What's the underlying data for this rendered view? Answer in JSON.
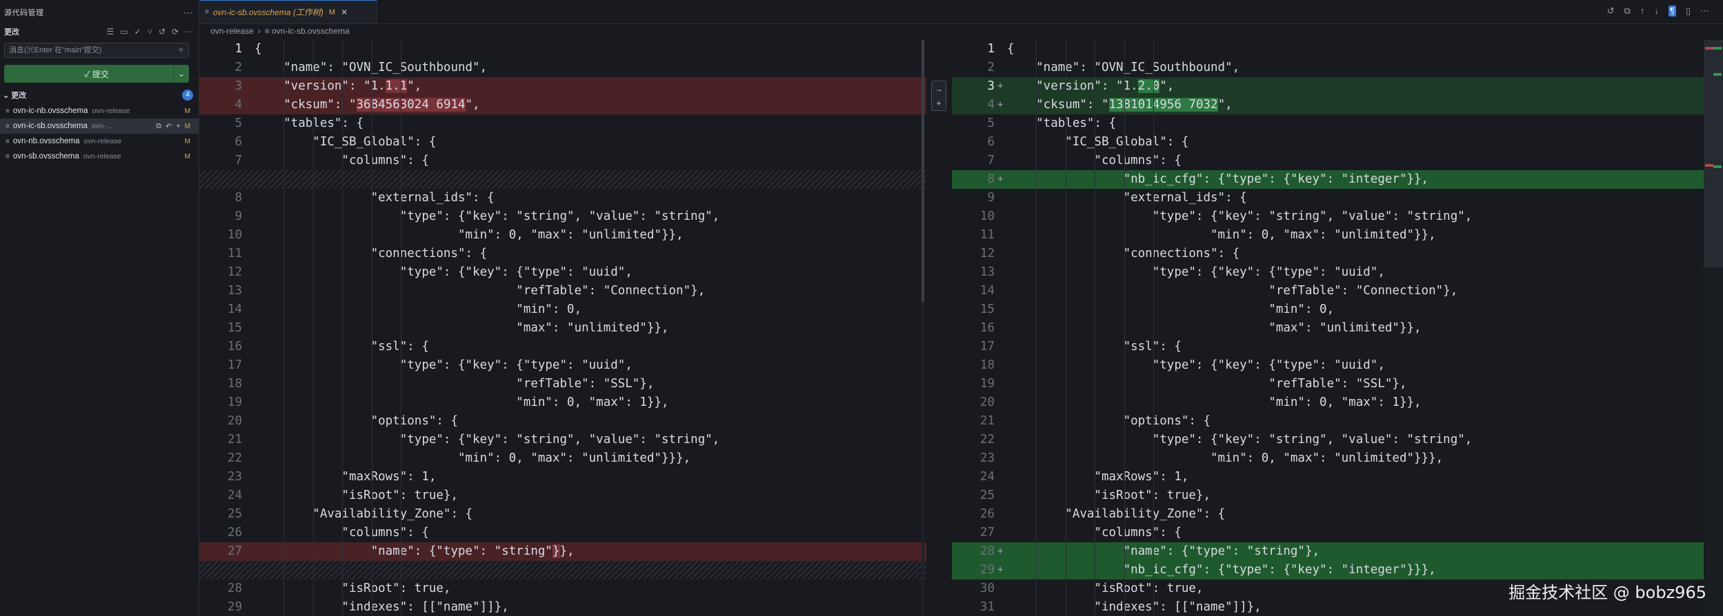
{
  "sidebar": {
    "title": "源代码管理",
    "section_label": "更改",
    "commit_placeholder": "消息(⌘Enter 在\"main\"提交)",
    "commit_button": "✓ 提交",
    "changes_label": "更改",
    "changes_count": "4",
    "files": [
      {
        "name": "ovn-ic-nb.ovsschema",
        "dir": "ovn-release",
        "status": "M"
      },
      {
        "name": "ovn-ic-sb.ovsschema",
        "dir": "ovn-...",
        "status": "M"
      },
      {
        "name": "ovn-nb.ovsschema",
        "dir": "ovn-release",
        "status": "M"
      },
      {
        "name": "ovn-sb.ovsschema",
        "dir": "ovn-release",
        "status": "M"
      }
    ]
  },
  "tab": {
    "title": "ovn-ic-sb.ovsschema (工作树)",
    "status": "M"
  },
  "breadcrumb": [
    "ovn-release",
    "ovn-ic-sb.ovsschema"
  ],
  "left": [
    {
      "n": "1",
      "t": "{"
    },
    {
      "n": "2",
      "t": "    \"name\": \"OVN_IC_Southbound\","
    },
    {
      "n": "3",
      "t": "    \"version\": \"1.1.1\",",
      "k": "del",
      "pre": "    \"version\": \"1.",
      "hl": "1.1",
      "post": "\","
    },
    {
      "n": "4",
      "t": "    \"cksum\": \"3684563024 6914\",",
      "k": "del",
      "pre": "    \"cksum\": \"",
      "hl": "3684563024 6914",
      "post": "\","
    },
    {
      "n": "5",
      "t": "    \"tables\": {"
    },
    {
      "n": "6",
      "t": "        \"IC_SB_Global\": {"
    },
    {
      "n": "7",
      "t": "            \"columns\": {"
    },
    {
      "n": "",
      "t": "",
      "k": "hatch"
    },
    {
      "n": "8",
      "t": "                \"external_ids\": {"
    },
    {
      "n": "9",
      "t": "                    \"type\": {\"key\": \"string\", \"value\": \"string\","
    },
    {
      "n": "10",
      "t": "                            \"min\": 0, \"max\": \"unlimited\"}},"
    },
    {
      "n": "11",
      "t": "                \"connections\": {"
    },
    {
      "n": "12",
      "t": "                    \"type\": {\"key\": {\"type\": \"uuid\","
    },
    {
      "n": "13",
      "t": "                                    \"refTable\": \"Connection\"},"
    },
    {
      "n": "14",
      "t": "                                    \"min\": 0,"
    },
    {
      "n": "15",
      "t": "                                    \"max\": \"unlimited\"}},"
    },
    {
      "n": "16",
      "t": "                \"ssl\": {"
    },
    {
      "n": "17",
      "t": "                    \"type\": {\"key\": {\"type\": \"uuid\","
    },
    {
      "n": "18",
      "t": "                                    \"refTable\": \"SSL\"},"
    },
    {
      "n": "19",
      "t": "                                    \"min\": 0, \"max\": 1}},"
    },
    {
      "n": "20",
      "t": "                \"options\": {"
    },
    {
      "n": "21",
      "t": "                    \"type\": {\"key\": \"string\", \"value\": \"string\","
    },
    {
      "n": "22",
      "t": "                            \"min\": 0, \"max\": \"unlimited\"}}},"
    },
    {
      "n": "23",
      "t": "            \"maxRows\": 1,"
    },
    {
      "n": "24",
      "t": "            \"isRoot\": true},"
    },
    {
      "n": "25",
      "t": "        \"Availability_Zone\": {"
    },
    {
      "n": "26",
      "t": "            \"columns\": {"
    },
    {
      "n": "27",
      "t": "                \"name\": {\"type\": \"string\"}},",
      "k": "del",
      "pre": "                \"name\": {\"type\": \"string\"",
      "hl": "}",
      "post": "},"
    },
    {
      "n": "",
      "t": "",
      "k": "hatch"
    },
    {
      "n": "28",
      "t": "            \"isRoot\": true,"
    },
    {
      "n": "29",
      "t": "            \"indexes\": [[\"name\"]]},"
    }
  ],
  "right": [
    {
      "n": "1",
      "t": "{"
    },
    {
      "n": "2",
      "t": "    \"name\": \"OVN_IC_Southbound\","
    },
    {
      "n": "3",
      "t": "    \"version\": \"1.2.0\",",
      "k": "addsoft",
      "pre": "    \"version\": \"1.",
      "hl": "2.0",
      "post": "\",",
      "cur": true
    },
    {
      "n": "4",
      "t": "    \"cksum\": \"1381014956 7032\",",
      "k": "addsoft",
      "pre": "    \"cksum\": \"",
      "hl": "1381014956 7032",
      "post": "\","
    },
    {
      "n": "5",
      "t": "    \"tables\": {"
    },
    {
      "n": "6",
      "t": "        \"IC_SB_Global\": {"
    },
    {
      "n": "7",
      "t": "            \"columns\": {"
    },
    {
      "n": "8",
      "t": "                \"nb_ic_cfg\": {\"type\": {\"key\": \"integer\"}},",
      "k": "add"
    },
    {
      "n": "9",
      "t": "                \"external_ids\": {"
    },
    {
      "n": "10",
      "t": "                    \"type\": {\"key\": \"string\", \"value\": \"string\","
    },
    {
      "n": "11",
      "t": "                            \"min\": 0, \"max\": \"unlimited\"}},"
    },
    {
      "n": "12",
      "t": "                \"connections\": {"
    },
    {
      "n": "13",
      "t": "                    \"type\": {\"key\": {\"type\": \"uuid\","
    },
    {
      "n": "14",
      "t": "                                    \"refTable\": \"Connection\"},"
    },
    {
      "n": "15",
      "t": "                                    \"min\": 0,"
    },
    {
      "n": "16",
      "t": "                                    \"max\": \"unlimited\"}},"
    },
    {
      "n": "17",
      "t": "                \"ssl\": {"
    },
    {
      "n": "18",
      "t": "                    \"type\": {\"key\": {\"type\": \"uuid\","
    },
    {
      "n": "19",
      "t": "                                    \"refTable\": \"SSL\"},"
    },
    {
      "n": "20",
      "t": "                                    \"min\": 0, \"max\": 1}},"
    },
    {
      "n": "21",
      "t": "                \"options\": {"
    },
    {
      "n": "22",
      "t": "                    \"type\": {\"key\": \"string\", \"value\": \"string\","
    },
    {
      "n": "23",
      "t": "                            \"min\": 0, \"max\": \"unlimited\"}}},"
    },
    {
      "n": "24",
      "t": "            \"maxRows\": 1,"
    },
    {
      "n": "25",
      "t": "            \"isRoot\": true},"
    },
    {
      "n": "26",
      "t": "        \"Availability_Zone\": {"
    },
    {
      "n": "27",
      "t": "            \"columns\": {"
    },
    {
      "n": "28",
      "t": "                \"name\": {\"type\": \"string\"},",
      "k": "add"
    },
    {
      "n": "29",
      "t": "                \"nb_ic_cfg\": {\"type\": {\"key\": \"integer\"}}},",
      "k": "add"
    },
    {
      "n": "30",
      "t": "            \"isRoot\": true,"
    },
    {
      "n": "31",
      "t": "            \"indexes\": [[\"name\"]]},"
    }
  ],
  "watermark": "掘金技术社区 @ bobz965"
}
